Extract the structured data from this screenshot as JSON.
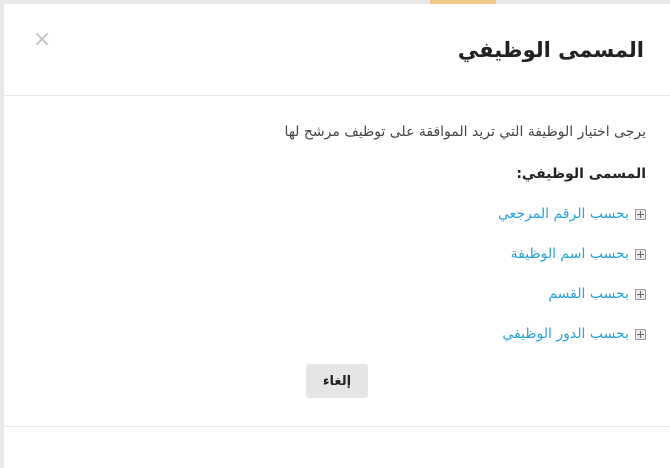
{
  "dialog": {
    "title": "المسمى الوظيفي",
    "close_symbol": "×",
    "instruction": "يرجى اختيار الوظيفة التي تريد الموافقة على توظيف مرشح لها",
    "field_label": "المسمى الوظيفي:",
    "options": [
      {
        "label": "بحسب الرقم المرجعي",
        "icon": "expand-plus-icon"
      },
      {
        "label": "بحسب اسم الوظيفة",
        "icon": "expand-plus-icon"
      },
      {
        "label": "بحسب القسم",
        "icon": "expand-plus-icon"
      },
      {
        "label": "بحسب الدور الوظيفي",
        "icon": "expand-plus-icon"
      }
    ],
    "cancel_label": "إلغاء"
  },
  "colors": {
    "link": "#2aa3d6",
    "title": "#222222",
    "button_bg": "#e6e6e6",
    "backdrop_accent": "#f3c98b"
  }
}
